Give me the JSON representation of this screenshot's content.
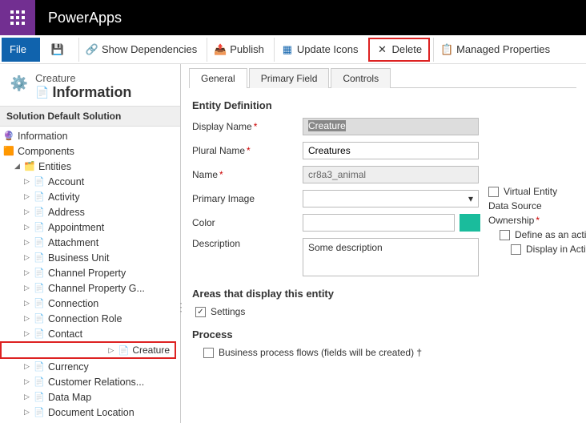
{
  "app": {
    "name": "PowerApps"
  },
  "cmdbar": {
    "file": "File",
    "dependencies": "Show Dependencies",
    "publish": "Publish",
    "updateicons": "Update Icons",
    "delete": "Delete",
    "managed": "Managed Properties"
  },
  "page": {
    "crumb": "Creature",
    "title": "Information"
  },
  "solution_header": "Solution Default Solution",
  "tree": {
    "information": "Information",
    "components": "Components",
    "entities": "Entities",
    "items": [
      "Account",
      "Activity",
      "Address",
      "Appointment",
      "Attachment",
      "Business Unit",
      "Channel Property",
      "Channel Property G...",
      "Connection",
      "Connection Role",
      "Contact",
      "Creature",
      "Currency",
      "Customer Relations...",
      "Data Map",
      "Document Location"
    ],
    "selected": "Creature"
  },
  "tabs": {
    "general": "General",
    "primary": "Primary Field",
    "controls": "Controls"
  },
  "section1": "Entity Definition",
  "fields": {
    "display_name_label": "Display Name",
    "display_name": "Creature",
    "plural_label": "Plural Name",
    "plural": "Creatures",
    "name_label": "Name",
    "name": "cr8a3_animal",
    "primary_image_label": "Primary Image",
    "color_label": "Color",
    "description_label": "Description",
    "description": "Some description"
  },
  "rightcol": {
    "virtual": "Virtual Entity",
    "datasource": "Data Source",
    "ownership": "Ownership",
    "define_activity": "Define as an activity",
    "display_activity": "Display in Activiti"
  },
  "section2": "Areas that display this entity",
  "area_settings": "Settings",
  "section3": "Process",
  "process_bpf": "Business process flows (fields will be created) †"
}
